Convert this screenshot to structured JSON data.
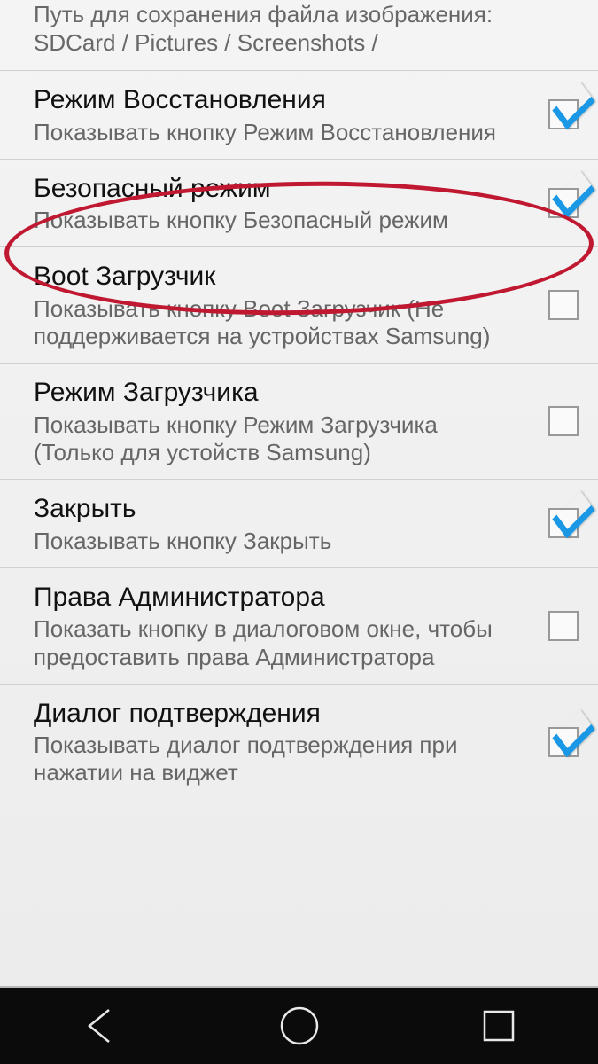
{
  "settings": [
    {
      "title": "",
      "subtitle": "Путь для сохранения файла изображения: SDCard / Pictures / Screenshots /",
      "checked": null
    },
    {
      "title": "Режим Восстановления",
      "subtitle": "Показывать кнопку Режим Восстановления",
      "checked": true
    },
    {
      "title": "Безопасный режим",
      "subtitle": "Показывать кнопку Безопасный режим",
      "checked": true
    },
    {
      "title": "Boot Загрузчик",
      "subtitle": "Показывать кнопку Boot Загрузчик (Не поддерживается на устройствах Samsung)",
      "checked": false
    },
    {
      "title": "Режим Загрузчика",
      "subtitle": "Показывать кнопку Режим Загрузчика (Только для устойств Samsung)",
      "checked": false
    },
    {
      "title": "Закрыть",
      "subtitle": "Показывать кнопку Закрыть",
      "checked": true
    },
    {
      "title": "Права Администратора",
      "subtitle": "Показать кнопку в диалоговом окне, чтобы предоставить права Администратора",
      "checked": false
    },
    {
      "title": "Диалог подтверждения",
      "subtitle": "Показывать диалог подтверждения при нажатии на виджет",
      "checked": true
    }
  ]
}
